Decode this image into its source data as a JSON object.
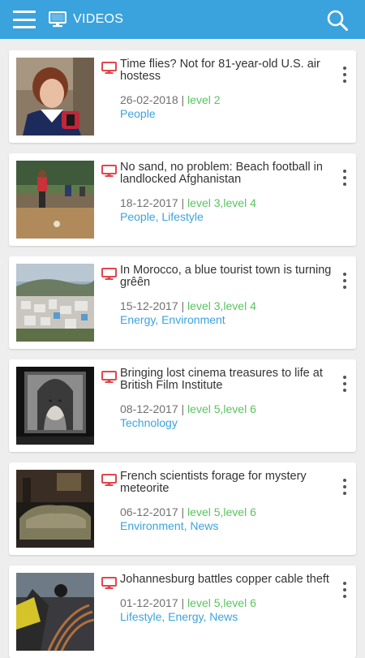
{
  "app_bar": {
    "title": "VIDEOS",
    "menu_icon": "hamburger-menu-icon",
    "section_icon": "monitor-icon",
    "search_icon": "search-icon",
    "color": "#3aa3de"
  },
  "colors": {
    "accent": "#3aa3de",
    "level": "#59c35f",
    "video_icon": "#e0474c"
  },
  "videos": [
    {
      "title": "Time flies? Not for 81-year-old U.S. air hostess",
      "date": "26-02-2018",
      "separator": "|",
      "levels": "level 2",
      "categories": "People",
      "thumbnail": "flight attendant portrait"
    },
    {
      "title": "No sand, no problem: Beach football in landlocked Afghanistan",
      "date": "18-12-2017",
      "separator": "|",
      "levels": "level 3,level 4",
      "categories": "People, Lifestyle",
      "thumbnail": "football players"
    },
    {
      "title": "In Morocco, a blue tourist town is turning grêên",
      "date": "15-12-2017",
      "separator": "|",
      "levels": "level 3,level 4",
      "categories": "Energy, Environment",
      "thumbnail": "hillside town"
    },
    {
      "title": "Bringing lost cinema treasures to life at British Film Institute",
      "date": "08-12-2017",
      "separator": "|",
      "levels": "level 5,level 6",
      "categories": "Technology",
      "thumbnail": "film screen"
    },
    {
      "title": "French scientists forage for mystery meteorite",
      "date": "06-12-2017",
      "separator": "|",
      "levels": "level 5,level 6",
      "categories": "Environment, News",
      "thumbnail": "meteorite rock"
    },
    {
      "title": "Johannesburg battles copper cable theft",
      "date": "01-12-2017",
      "separator": "|",
      "levels": "level 5,level 6",
      "categories": "Lifestyle, Energy, News",
      "thumbnail": "copper cables"
    }
  ]
}
